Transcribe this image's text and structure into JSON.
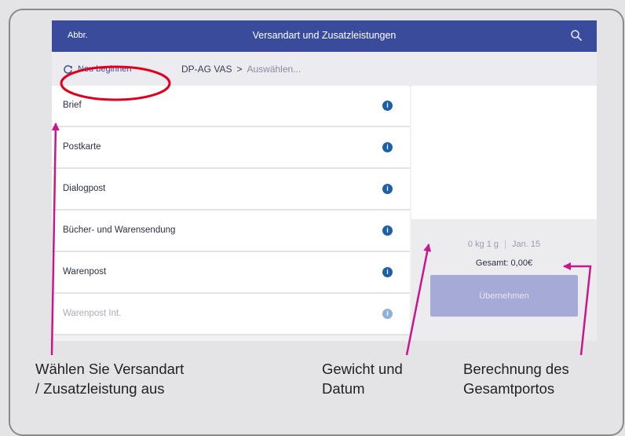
{
  "titlebar": {
    "cancel_label": "Abbr.",
    "title": "Versandart und Zusatzleistungen"
  },
  "breadcrumb": {
    "restart_label": "Neu beginnen",
    "path_root": "DP-AG VAS",
    "separator": ">",
    "path_pending": "Auswählen..."
  },
  "list": {
    "items": [
      {
        "label": "Brief"
      },
      {
        "label": "Postkarte"
      },
      {
        "label": "Dialogpost"
      },
      {
        "label": "Bücher- und Warensendung"
      },
      {
        "label": "Warenpost"
      },
      {
        "label": "Warenpost Int."
      }
    ],
    "info_glyph": "i"
  },
  "summary": {
    "weight": "0 kg 1 g",
    "date": "Jan. 15",
    "total": "Gesamt: 0,00€",
    "apply_label": "Übernehmen"
  },
  "annotations": {
    "caption_select_line1": "Wählen Sie Versandart",
    "caption_select_line2": "/ Zusatzleistung aus",
    "caption_weight_line1": "Gewicht und",
    "caption_weight_line2": "Datum",
    "caption_total_line1": "Berechnung des",
    "caption_total_line2": "Gesamtportos"
  },
  "colors": {
    "brand": "#3a4b9c",
    "info": "#1d5fa8",
    "highlight_ellipse": "#e0001b",
    "arrow": "#c8168c"
  },
  "icons": {
    "search": "search-icon",
    "restart": "restart-icon",
    "info": "info-icon"
  }
}
